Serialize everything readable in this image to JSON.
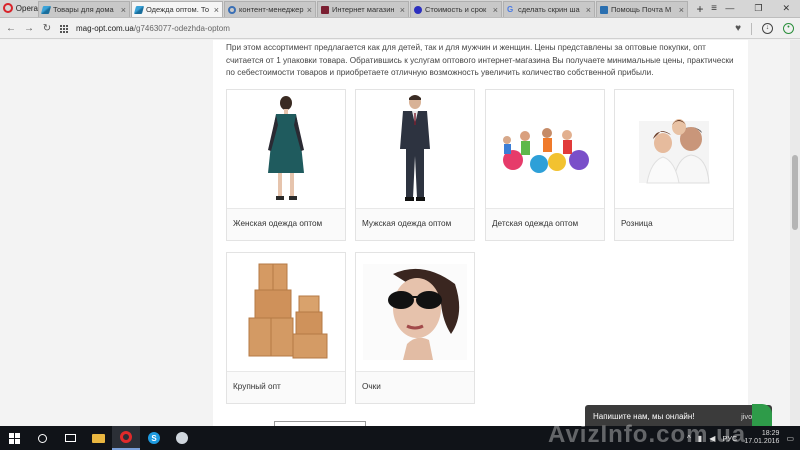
{
  "browser": {
    "menu_label": "Opera",
    "tabs": [
      {
        "label": "Товары для дома",
        "icon": "feather-icon",
        "active": false
      },
      {
        "label": "Одежда оптом. То",
        "icon": "feather-icon",
        "active": true
      },
      {
        "label": "контент-менеджер",
        "icon": "globe-icon",
        "active": false
      },
      {
        "label": "Интернет магазин",
        "icon": "book-icon",
        "active": false
      },
      {
        "label": "Стоимость и срок",
        "icon": "blue-circle-icon",
        "active": false
      },
      {
        "label": "сделать скрин ша",
        "icon": "google-icon",
        "active": false
      },
      {
        "label": "Помощь Почта М",
        "icon": "mail-icon",
        "active": false
      }
    ],
    "url_host": "mag-opt.com.ua",
    "url_path": "/g7463077-odezhda-optom"
  },
  "page": {
    "intro": "При этом ассортимент предлагается как для детей, так и для мужчин и женщин. Цены представлены за оптовые покупки, опт считается от 1 упаковки товара. Обратившись к услугам оптового интернет-магазина Вы получаете минимальные цены, практически по себестоимости товаров и приобретаете отличную возможность увеличить количество собственной прибыли.",
    "categories": [
      {
        "label": "Женская одежда оптом"
      },
      {
        "label": "Мужская одежда оптом"
      },
      {
        "label": "Детская одежда оптом"
      },
      {
        "label": "Розница"
      },
      {
        "label": "Крупный опт"
      },
      {
        "label": "Очки"
      }
    ]
  },
  "chat": {
    "message": "Напишите нам, мы онлайн!",
    "brand": "jivosite"
  },
  "taskbar": {
    "lang": "РУС",
    "time": "18:29",
    "date": "17.01.2016"
  },
  "watermark": "AvizInfo.com.ua"
}
